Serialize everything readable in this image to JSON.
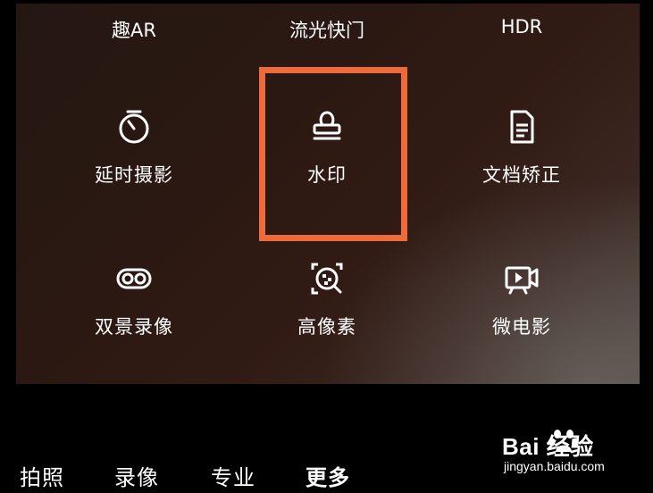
{
  "top_modes": [
    "趣AR",
    "流光快门",
    "HDR"
  ],
  "modes": [
    {
      "label": "延时摄影",
      "icon": "timer-icon"
    },
    {
      "label": "水印",
      "icon": "stamp-icon"
    },
    {
      "label": "文档矫正",
      "icon": "document-icon"
    },
    {
      "label": "双景录像",
      "icon": "dual-view-icon"
    },
    {
      "label": "高像素",
      "icon": "high-pixel-icon"
    },
    {
      "label": "微电影",
      "icon": "micro-movie-icon"
    }
  ],
  "bottom_tabs": [
    {
      "label": "拍照",
      "active": false
    },
    {
      "label": "录像",
      "active": false
    },
    {
      "label": "专业",
      "active": false
    },
    {
      "label": "更多",
      "active": true
    }
  ],
  "watermark": {
    "logo": "Bai  经验",
    "sub": "jingyan.baidu.com"
  },
  "colors": {
    "highlight": "#ef6a3a",
    "text": "#ffffff"
  }
}
